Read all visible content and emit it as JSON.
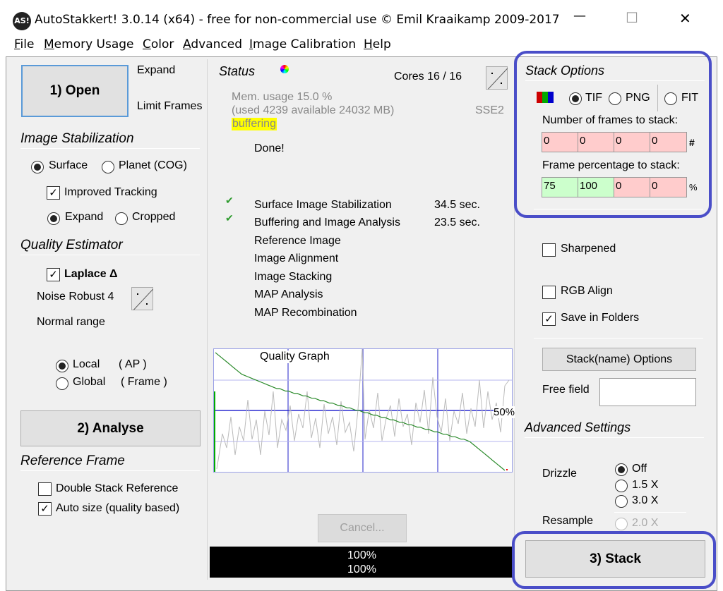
{
  "window": {
    "app_icon": "AS!",
    "title": "AutoStakkert! 3.0.14 (x64) - free for non-commercial use © Emil Kraaikamp 2009-2017",
    "minimize": "—",
    "maximize": "☐",
    "close": "✕"
  },
  "menu": [
    {
      "u": "F",
      "rest": "ile"
    },
    {
      "u": "M",
      "rest": "emory Usage"
    },
    {
      "u": "C",
      "rest": "olor"
    },
    {
      "u": "A",
      "rest": "dvanced"
    },
    {
      "u": "I",
      "rest": "mage Calibration"
    },
    {
      "u": "H",
      "rest": "elp"
    }
  ],
  "left": {
    "open_button": "1) Open",
    "expand_label": "Expand",
    "limit_frames_label": "Limit Frames",
    "image_stabilization_title": "Image Stabilization",
    "surface_label": "Surface",
    "planet_label": "Planet (COG)",
    "improved_tracking_label": "Improved Tracking",
    "expand_radio_label": "Expand",
    "cropped_label": "Cropped",
    "quality_estimator_title": "Quality Estimator",
    "laplace_label": "Laplace Δ",
    "noise_robust_label": "Noise Robust 4",
    "normal_range_label": "Normal range",
    "local_label": "Local",
    "local_paren": "( AP )",
    "global_label": "Global",
    "global_paren": "( Frame )",
    "analyse_button": "2) Analyse",
    "reference_frame_title": "Reference Frame",
    "double_stack_label": "Double Stack Reference",
    "auto_size_label": "Auto size (quality based)"
  },
  "center": {
    "status_title": "Status",
    "cores": "Cores 16 / 16",
    "mem_usage": "Mem. usage 15.0 %",
    "mem_detail": "(used 4239 available 24032 MB)",
    "sse": "SSE2",
    "buffering": "buffering",
    "done": "Done!",
    "check_mark": "✔",
    "steps": [
      {
        "name": "Surface Image Stabilization",
        "time": "34.5 sec.",
        "done": true
      },
      {
        "name": "Buffering and Image Analysis",
        "time": "23.5 sec.",
        "done": true
      },
      {
        "name": "Reference Image",
        "time": "",
        "done": false
      },
      {
        "name": "Image Alignment",
        "time": "",
        "done": false
      },
      {
        "name": "Image Stacking",
        "time": "",
        "done": false
      },
      {
        "name": "MAP Analysis",
        "time": "",
        "done": false
      },
      {
        "name": "MAP Recombination",
        "time": "",
        "done": false
      }
    ],
    "graph_title": "Quality Graph",
    "graph_percent": "50%",
    "cancel_button": "Cancel...",
    "progress_line1": "100%",
    "progress_line2": "100%"
  },
  "right": {
    "stack_options_title": "Stack Options",
    "tif_label": "TIF",
    "png_label": "PNG",
    "fit_label": "FIT",
    "frames_to_stack_label": "Number of frames to stack:",
    "frames_values": [
      "0",
      "0",
      "0",
      "0"
    ],
    "frames_suffix": "#",
    "percentage_label": "Frame percentage to stack:",
    "percentage_values": [
      "75",
      "100",
      "0",
      "0"
    ],
    "percentage_suffix": "%",
    "sharpened_label": "Sharpened",
    "rgb_align_label": "RGB Align",
    "save_in_folders_label": "Save in Folders",
    "stack_name_options_button": "Stack(name) Options",
    "free_field_label": "Free field",
    "free_field_value": "",
    "advanced_settings_title": "Advanced Settings",
    "drizzle_label": "Drizzle",
    "drizzle_off": "Off",
    "drizzle_15": "1.5 X",
    "drizzle_30": "3.0 X",
    "resample_label": "Resample",
    "resample_20": "2.0 X",
    "stack_button": "3) Stack"
  },
  "colors": {
    "highlight": "#4a4ec8",
    "buffering_bg": "#ffff00",
    "green_cell": "#ccffcc",
    "pink_cell": "#ffcccc",
    "check": "#2e9b2e"
  },
  "quality_graph_data": {
    "frames": 100,
    "sorted_quality_percent": [
      98,
      96,
      94,
      92,
      90,
      88,
      86,
      84,
      82,
      80,
      79,
      78,
      77,
      76,
      75,
      74,
      73,
      72,
      71,
      70,
      69,
      68,
      68,
      67,
      66,
      66,
      65,
      64,
      64,
      63,
      62,
      62,
      61,
      60,
      60,
      59,
      58,
      58,
      57,
      56,
      56,
      55,
      54,
      54,
      53,
      52,
      52,
      51,
      50,
      50,
      49,
      48,
      48,
      47,
      46,
      46,
      45,
      44,
      44,
      43,
      42,
      42,
      41,
      40,
      40,
      39,
      38,
      38,
      37,
      36,
      36,
      35,
      34,
      34,
      33,
      32,
      32,
      31,
      30,
      30,
      29,
      28,
      28,
      27,
      26,
      26,
      25,
      24,
      22,
      20,
      18,
      16,
      14,
      12,
      10,
      8,
      6,
      4,
      2,
      0
    ],
    "reference_percent": 50
  }
}
